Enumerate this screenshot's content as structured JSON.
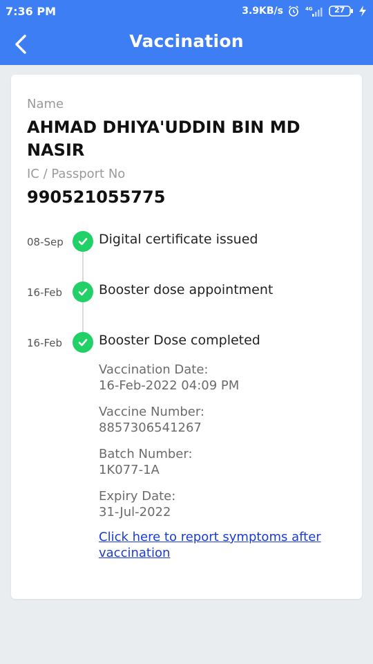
{
  "status_bar": {
    "time": "7:36 PM",
    "speed": "3.9KB/s",
    "battery": "27",
    "icons": [
      "alarm-icon",
      "signal-icon",
      "battery-icon",
      "charging-icon"
    ]
  },
  "app_bar": {
    "title": "Vaccination",
    "back_icon": "chevron-left-icon",
    "color": "#3d7ef5"
  },
  "profile": {
    "name_label": "Name",
    "name_line1": "AHMAD DHIYA'UDDIN BIN MD",
    "name_line2": "NASIR",
    "id_label": "IC / Passport No",
    "id_value": "990521055775"
  },
  "timeline": [
    {
      "date": "08-Sep",
      "text": "Digital certificate issued",
      "icon": "check-circle-icon"
    },
    {
      "date": "16-Feb",
      "text": "Booster dose appointment",
      "icon": "check-circle-icon"
    },
    {
      "date": "16-Feb",
      "text": "Booster Dose completed",
      "icon": "check-circle-icon"
    }
  ],
  "details": {
    "vaccination_date_label": "Vaccination Date:",
    "vaccination_date": "16-Feb-2022 04:09 PM",
    "vaccine_number_label": "Vaccine Number:",
    "vaccine_number": "8857306541267",
    "batch_number_label": "Batch Number:",
    "batch_number": "1K077-1A",
    "expiry_date_label": "Expiry Date:",
    "expiry_date": "31-Jul-2022"
  },
  "report_link": {
    "line1": "Click here to report symptoms after",
    "line2": "vaccination"
  },
  "colors": {
    "accent": "#3d7ef5",
    "check_green": "#21d168",
    "link": "#1a3cd6"
  }
}
